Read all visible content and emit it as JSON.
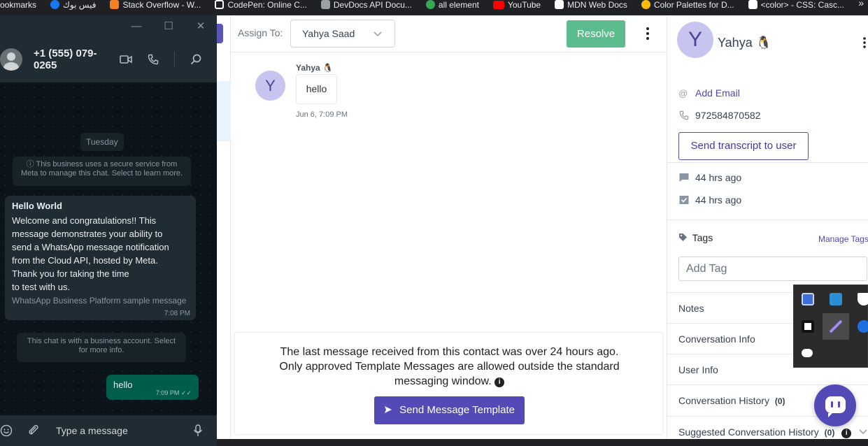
{
  "bookmarks": {
    "items": [
      {
        "label": "ookmarks",
        "icon": "bookmarks-icon",
        "color": "#202124"
      },
      {
        "label": "فيس بوك",
        "icon": "facebook-icon",
        "color": "#1877f2"
      },
      {
        "label": "Stack Overflow - W...",
        "icon": "stackoverflow-icon",
        "color": "#f48024"
      },
      {
        "label": "CodePen: Online C...",
        "icon": "codepen-icon",
        "color": "#ffffff"
      },
      {
        "label": "DevDocs API Docu...",
        "icon": "devdocs-icon",
        "color": "#9aa0a6"
      },
      {
        "label": "all element",
        "icon": "element-icon",
        "color": "#34a853"
      },
      {
        "label": "YouTube",
        "icon": "youtube-icon",
        "color": "#ff0000"
      },
      {
        "label": "MDN Web Docs",
        "icon": "mdn-icon",
        "color": "#ffffff"
      },
      {
        "label": "Color Palettes for D...",
        "icon": "palette-icon",
        "color": "#fbbc04"
      },
      {
        "label": "<color> - CSS: Casc...",
        "icon": "mdn-icon",
        "color": "#ffffff"
      }
    ],
    "more": "»"
  },
  "whatsapp": {
    "window_controls": {
      "minimize": "—",
      "maximize": "☐",
      "close": "✕"
    },
    "contact_phone": "+1 (555) 079-0265",
    "day_label": "Tuesday",
    "system_notice": "ⓘ This business uses a secure service from Meta to manage this chat. Select to learn more.",
    "incoming": {
      "title": "Hello World",
      "body": "Welcome and congratulations!! This\nmessage demonstrates your ability to\nsend a WhatsApp message notification\nfrom the Cloud API, hosted by Meta.\nThank you for taking the time\nto test with us.",
      "footer": "WhatsApp Business Platform sample message",
      "time": "7:08 PM"
    },
    "business_notice": "This chat is with a business account. Select for more info.",
    "outgoing": {
      "text": "hello",
      "time": "7:09 PM ✓✓"
    },
    "input_placeholder": "Type a message"
  },
  "conversation": {
    "assign_label": "Assign To:",
    "assignee": "Yahya Saad",
    "resolve_label": "Resolve",
    "message": {
      "avatar_letter": "Y",
      "sender": "Yahya 🐧",
      "text": "hello",
      "time": "Jun 6, 7:09 PM"
    },
    "window_notice": "The last message received from this contact was over 24 hours ago. Only approved Template Messages are allowed outside the standard messaging window.",
    "info_glyph": "i",
    "send_template_label": "Send Message Template"
  },
  "contact_panel": {
    "avatar_letter": "Y",
    "name": "Yahya 🐧",
    "add_email": "Add Email",
    "phone": "972584870582",
    "transcript_label": "Send transcript to user",
    "created_ago": "44 hrs ago",
    "last_activity_ago": "44 hrs ago",
    "tags_label": "Tags",
    "manage_tags": "Manage Tags",
    "add_tag_placeholder": "Add Tag",
    "sections": [
      {
        "label": "Notes",
        "count": ""
      },
      {
        "label": "Conversation Info",
        "count": ""
      },
      {
        "label": "User Info",
        "count": ""
      },
      {
        "label": "Conversation History",
        "count": "(0)"
      },
      {
        "label": "Suggested Conversation History",
        "count": "(0)"
      }
    ]
  },
  "colors": {
    "primary": "#534ab7",
    "resolve": "#5cbc8d",
    "whatsapp_outgoing": "#005c4b",
    "whatsapp_panel": "#202c33"
  }
}
